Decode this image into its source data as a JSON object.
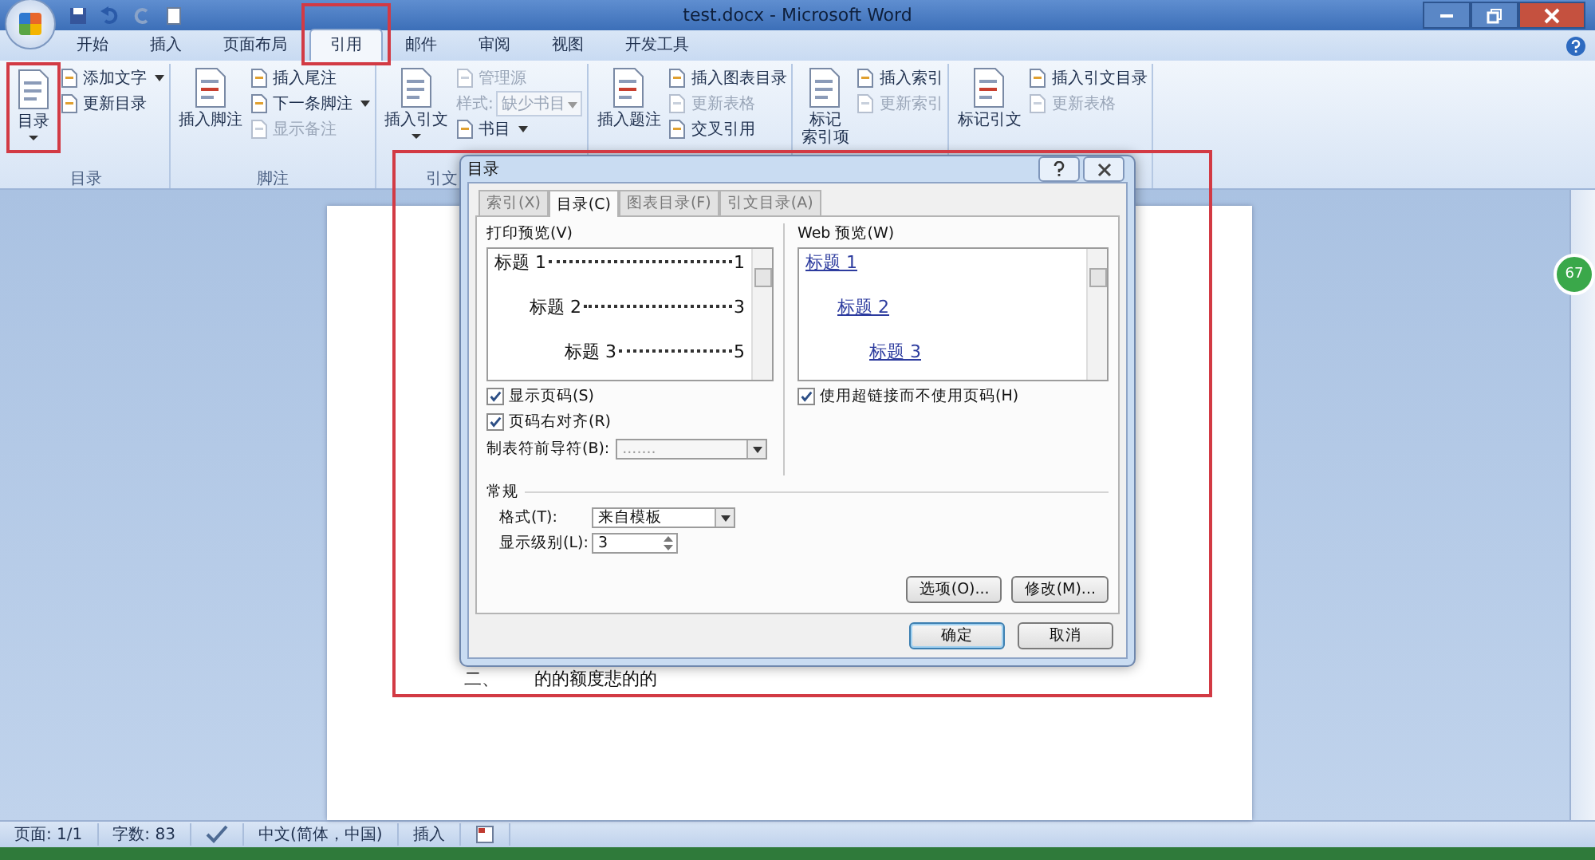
{
  "window": {
    "title": "test.docx - Microsoft Word"
  },
  "tabs": [
    {
      "label": "开始",
      "selected": false
    },
    {
      "label": "插入",
      "selected": false
    },
    {
      "label": "页面布局",
      "selected": false
    },
    {
      "label": "引用",
      "selected": true
    },
    {
      "label": "邮件",
      "selected": false
    },
    {
      "label": "审阅",
      "selected": false
    },
    {
      "label": "视图",
      "selected": false
    },
    {
      "label": "开发工具",
      "selected": false
    }
  ],
  "ribbon": {
    "groups": [
      {
        "label": "目录",
        "items": [
          {
            "kind": "large",
            "label": "目录",
            "dropdown": true,
            "disabled": false
          },
          {
            "kind": "small",
            "label": "添加文字",
            "dropdown": true,
            "disabled": false
          },
          {
            "kind": "small",
            "label": "更新目录",
            "dropdown": false,
            "disabled": false
          }
        ]
      },
      {
        "label": "脚注",
        "items": [
          {
            "kind": "large",
            "label": "插入脚注",
            "dropdown": false,
            "disabled": false
          },
          {
            "kind": "small",
            "label": "插入尾注",
            "dropdown": false,
            "disabled": false
          },
          {
            "kind": "small",
            "label": "下一条脚注",
            "dropdown": true,
            "disabled": false
          },
          {
            "kind": "small",
            "label": "显示备注",
            "dropdown": false,
            "disabled": true
          }
        ]
      },
      {
        "label": "引文",
        "items": [
          {
            "kind": "large",
            "label": "插入引文",
            "dropdown": true,
            "disabled": false
          },
          {
            "kind": "small",
            "label": "管理源",
            "dropdown": false,
            "disabled": true
          },
          {
            "kind": "combo",
            "label": "样式:",
            "value": "缺少书目",
            "disabled": true
          },
          {
            "kind": "small",
            "label": "书目",
            "dropdown": true,
            "disabled": false
          }
        ]
      },
      {
        "items": [
          {
            "kind": "large",
            "label": "插入题注",
            "dropdown": false,
            "disabled": false
          },
          {
            "kind": "small",
            "label": "插入图表目录",
            "dropdown": false,
            "disabled": false
          },
          {
            "kind": "small",
            "label": "更新表格",
            "dropdown": false,
            "disabled": true
          },
          {
            "kind": "small",
            "label": "交叉引用",
            "dropdown": false,
            "disabled": false
          }
        ]
      },
      {
        "items": [
          {
            "kind": "large",
            "label_lines": [
              "标记",
              "索引项"
            ],
            "dropdown": false,
            "disabled": false
          },
          {
            "kind": "small",
            "label": "插入索引",
            "dropdown": false,
            "disabled": false
          },
          {
            "kind": "small",
            "label": "更新索引",
            "dropdown": false,
            "disabled": true
          }
        ]
      },
      {
        "items": [
          {
            "kind": "large",
            "label": "标记引文",
            "dropdown": false,
            "disabled": false
          },
          {
            "kind": "small",
            "label": "插入引文目录",
            "dropdown": false,
            "disabled": false
          },
          {
            "kind": "small",
            "label": "更新表格",
            "dropdown": false,
            "disabled": true
          }
        ]
      }
    ]
  },
  "document": {
    "paragraphs": [
      {
        "number": "二、",
        "text": "的的额度悲的的"
      }
    ]
  },
  "floating_badge": {
    "label": "67"
  },
  "dialog": {
    "title": "目录",
    "tabs": [
      {
        "label": "索引(X)",
        "selected": false
      },
      {
        "label": "目录(C)",
        "selected": true
      },
      {
        "label": "图表目录(F)",
        "selected": false
      },
      {
        "label": "引文目录(A)",
        "selected": false
      }
    ],
    "print_preview": {
      "label": "打印预览(V)",
      "entries": [
        {
          "text": "标题 1",
          "page": "1",
          "children": [
            {
              "text": "标题 2",
              "page": "3",
              "children": [
                {
                  "text": "标题 3",
                  "page": "5"
                }
              ]
            }
          ]
        }
      ]
    },
    "web_preview": {
      "label": "Web 预览(W)",
      "entries": [
        {
          "text": "标题 1",
          "children": [
            {
              "text": "标题 2",
              "children": [
                {
                  "text": "标题 3"
                }
              ]
            }
          ]
        }
      ]
    },
    "checkboxes": [
      {
        "label": "显示页码(S)",
        "checked": true
      },
      {
        "label": "页码右对齐(R)",
        "checked": true
      }
    ],
    "tab_leader": {
      "label": "制表符前导符(B):",
      "value": "......."
    },
    "hyperlink_checkbox": {
      "label": "使用超链接而不使用页码(H)",
      "checked": true
    },
    "general": {
      "heading": "常规",
      "format": {
        "label": "格式(T):",
        "value": "来自模板"
      },
      "levels": {
        "label": "显示级别(L):",
        "value": "3"
      }
    },
    "buttons": [
      {
        "label": "选项(O)..."
      },
      {
        "label": "修改(M)..."
      }
    ],
    "footer_buttons": [
      {
        "label": "确定",
        "default": true
      },
      {
        "label": "取消",
        "default": false
      }
    ]
  },
  "status_bar": {
    "items": [
      {
        "kind": "text",
        "label": "页面: 1/1"
      },
      {
        "kind": "text",
        "label": "字数: 83"
      },
      {
        "kind": "proofing"
      },
      {
        "kind": "text",
        "label": "中文(简体，中国)"
      },
      {
        "kind": "text",
        "label": "插入"
      },
      {
        "kind": "macro"
      }
    ]
  }
}
